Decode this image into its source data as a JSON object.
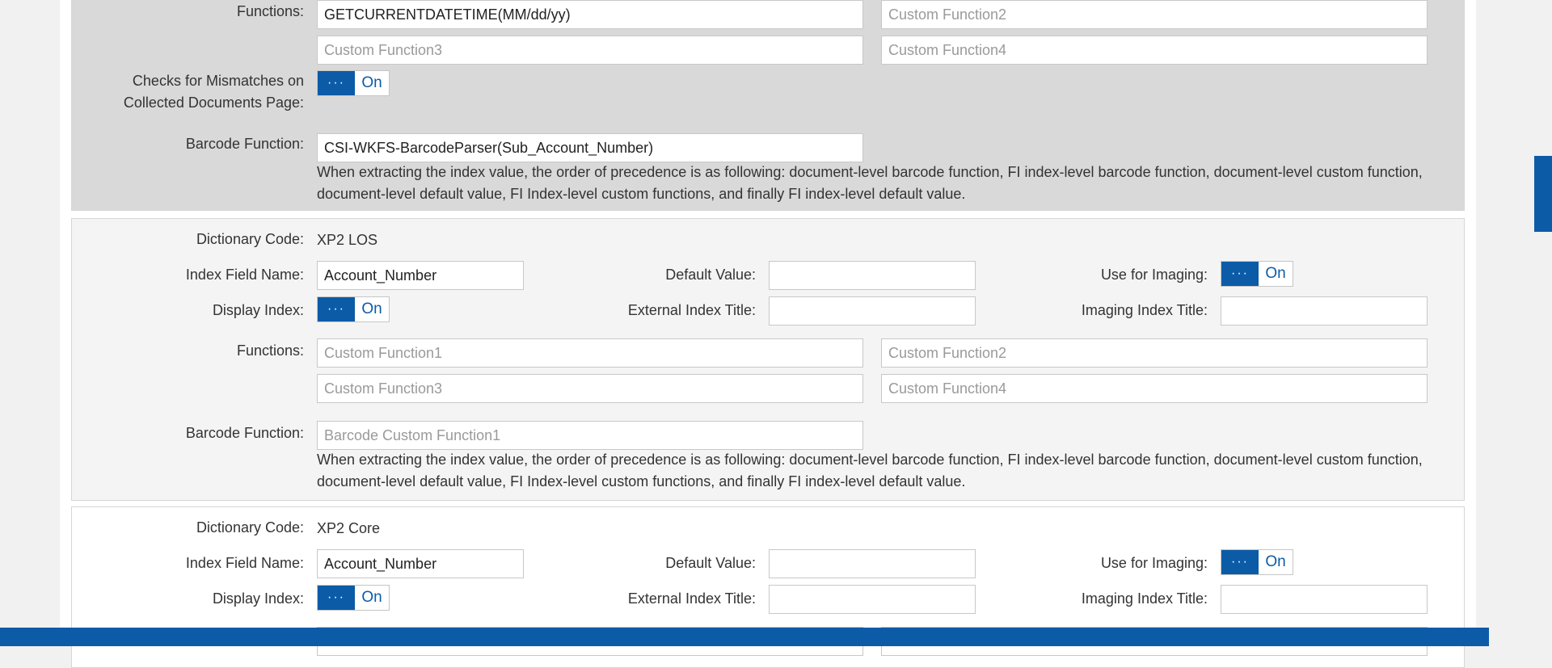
{
  "section_top": {
    "functions_label": "Functions:",
    "function1_value": "GETCURRENTDATETIME(MM/dd/yy)",
    "function2_placeholder": "Custom Function2",
    "function3_placeholder": "Custom Function3",
    "function4_placeholder": "Custom Function4",
    "mismatch_label": "Checks for Mismatches on Collected Documents Page:",
    "mismatch_toggle_state": "On",
    "barcode_label": "Barcode Function:",
    "barcode_value": "CSI-WKFS-BarcodeParser(Sub_Account_Number)",
    "note": "When extracting the index value, the order of precedence is as following: document-level barcode function, FI index-level barcode function, document-level custom function, document-level default value, FI Index-level custom functions, and finally FI index-level default value."
  },
  "section_los": {
    "dictionary_code_label": "Dictionary Code:",
    "dictionary_code_value": "XP2 LOS",
    "index_field_name_label": "Index Field Name:",
    "index_field_name_value": "Account_Number",
    "default_value_label": "Default Value:",
    "use_for_imaging_label": "Use for Imaging:",
    "use_for_imaging_state": "On",
    "display_index_label": "Display Index:",
    "display_index_state": "On",
    "external_index_title_label": "External Index Title:",
    "imaging_index_title_label": "Imaging Index Title:",
    "functions_label": "Functions:",
    "function1_placeholder": "Custom Function1",
    "function2_placeholder": "Custom Function2",
    "function3_placeholder": "Custom Function3",
    "function4_placeholder": "Custom Function4",
    "barcode_label": "Barcode Function:",
    "barcode_placeholder": "Barcode Custom Function1",
    "note": "When extracting the index value, the order of precedence is as following: document-level barcode function, FI index-level barcode function, document-level custom function, document-level default value, FI Index-level custom functions, and finally FI index-level default value."
  },
  "section_core": {
    "dictionary_code_label": "Dictionary Code:",
    "dictionary_code_value": "XP2 Core",
    "index_field_name_label": "Index Field Name:",
    "index_field_name_value": "Account_Number",
    "default_value_label": "Default Value:",
    "use_for_imaging_label": "Use for Imaging:",
    "use_for_imaging_state": "On",
    "display_index_label": "Display Index:",
    "display_index_state": "On",
    "external_index_title_label": "External Index Title:",
    "imaging_index_title_label": "Imaging Index Title:"
  },
  "toggle_knob_glyph": "···",
  "colors": {
    "accent": "#0c5ba7",
    "panel_gray": "#d9d9d9",
    "panel_light": "#f4f4f4"
  }
}
